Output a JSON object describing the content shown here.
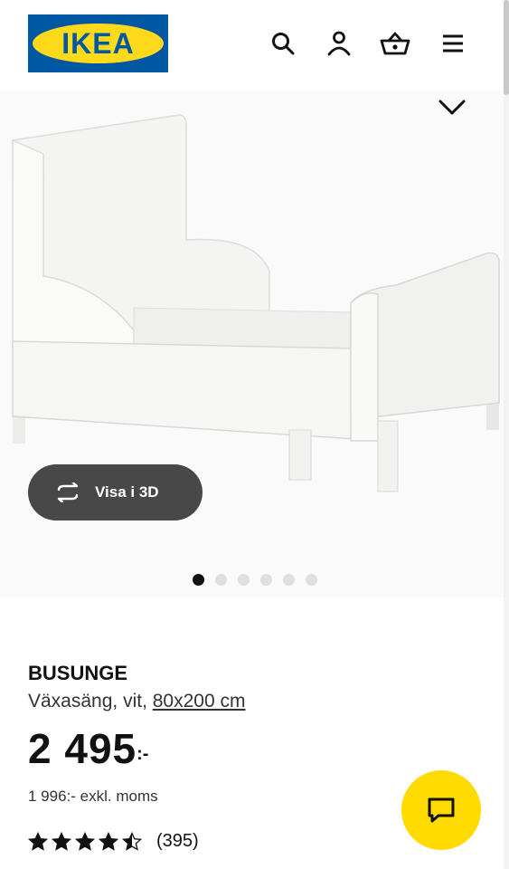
{
  "header": {
    "logo_text": "IKEA",
    "icons": [
      "search-icon",
      "profile-icon",
      "basket-icon",
      "menu-icon"
    ]
  },
  "gallery": {
    "view3d_label": "Visa i 3D",
    "dots_total": 6,
    "active_index": 0
  },
  "product": {
    "name": "BUSUNGE",
    "description": "Växasäng, vit,",
    "size": "80x200 cm",
    "price_integer": "2 495",
    "price_suffix": ":-",
    "price_excl": "1 996:- exkl. moms",
    "rating_value": 4.5,
    "rating_count": "(395)"
  },
  "colors": {
    "ikea_blue": "#0058a3",
    "ikea_yellow": "#ffda1a",
    "button_dark": "#484848",
    "chat_yellow": "#ffdb00"
  }
}
